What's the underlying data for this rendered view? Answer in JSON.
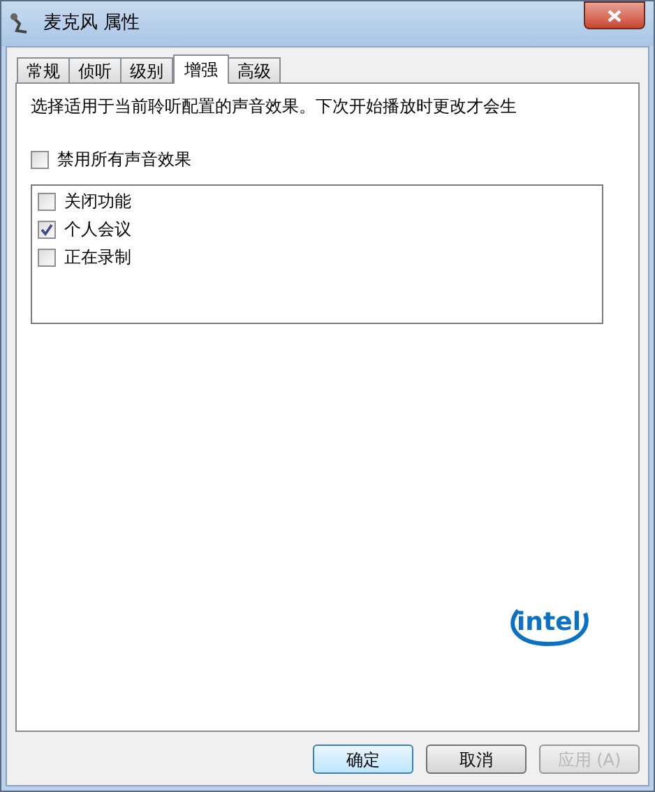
{
  "window": {
    "title": "麦克风 属性"
  },
  "tabs": [
    {
      "label": "常规",
      "selected": false
    },
    {
      "label": "侦听",
      "selected": false
    },
    {
      "label": "级别",
      "selected": false
    },
    {
      "label": "增强",
      "selected": true
    },
    {
      "label": "高级",
      "selected": false
    }
  ],
  "description": "选择适用于当前聆听配置的声音效果。下次开始播放时更改才会生",
  "disable_all": {
    "label": "禁用所有声音效果",
    "checked": false
  },
  "effects": [
    {
      "label": "关闭功能",
      "checked": false
    },
    {
      "label": "个人会议",
      "checked": true
    },
    {
      "label": "正在录制",
      "checked": false
    }
  ],
  "logo": {
    "text": "intel"
  },
  "buttons": [
    {
      "label": "确定",
      "kind": "default",
      "disabled": false
    },
    {
      "label": "取消",
      "kind": "normal",
      "disabled": false
    },
    {
      "label": "应用 (A)",
      "kind": "normal",
      "disabled": true
    }
  ]
}
